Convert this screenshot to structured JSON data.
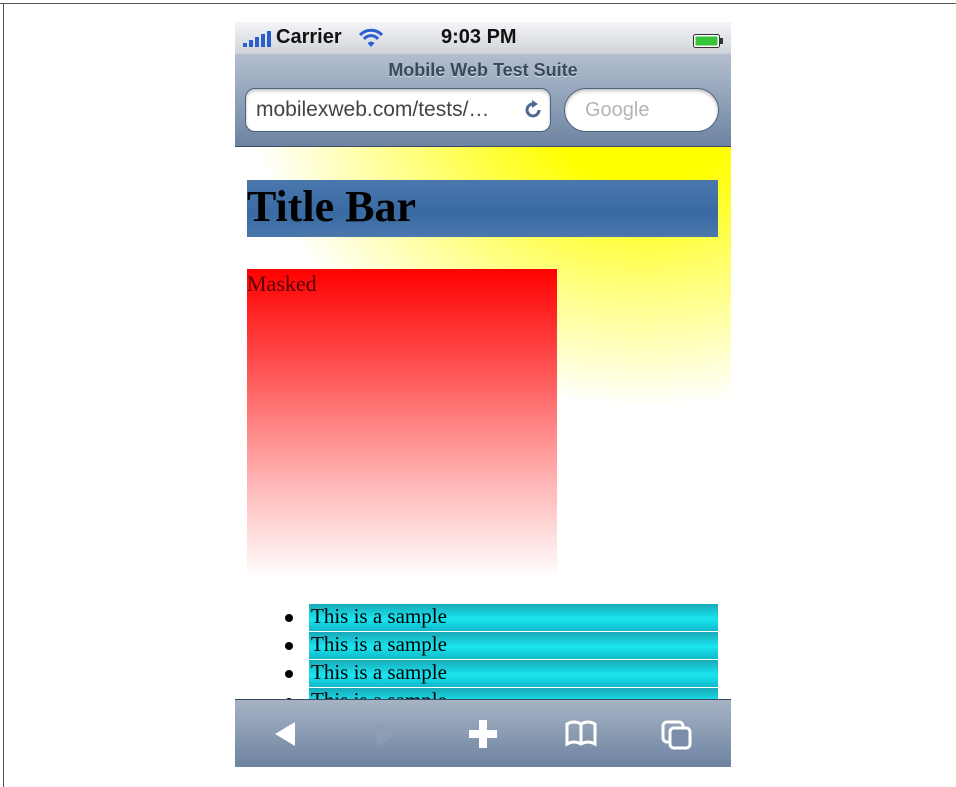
{
  "status_bar": {
    "carrier": "Carrier",
    "time": "9:03 PM",
    "icons": [
      "signal-icon",
      "wifi-icon",
      "battery-icon"
    ]
  },
  "browser": {
    "page_title": "Mobile Web Test Suite",
    "url": "mobilexweb.com/tests/…",
    "search_placeholder": "Google"
  },
  "content": {
    "title_bar": "Title Bar",
    "masked_label": "Masked",
    "list_items": [
      "This is a sample",
      "This is a sample",
      "This is a sample",
      "This is a sample"
    ]
  },
  "toolbar": {
    "buttons": [
      "back-icon",
      "forward-icon",
      "add-icon",
      "bookmarks-icon",
      "pages-icon"
    ]
  },
  "colors": {
    "title_bar_bg": "#4477aa",
    "masked_gradient_top": "#ff0000",
    "list_item_bg": "#19e5f0",
    "background_glow": "#ffff00"
  }
}
